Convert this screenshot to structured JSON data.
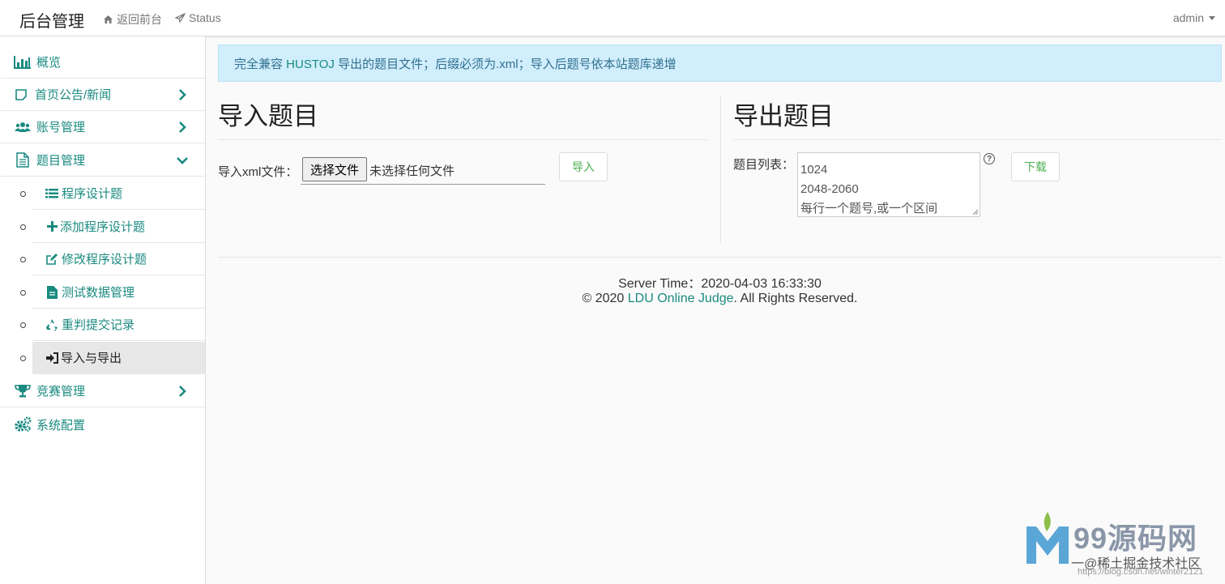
{
  "navbar": {
    "brand": "后台管理",
    "home_link": "返回前台",
    "status_link": "Status",
    "user": "admin"
  },
  "sidebar": {
    "items": [
      {
        "label": "概览",
        "icon": "bar-chart-icon"
      },
      {
        "label": "首页公告/新闻",
        "icon": "square-icon",
        "expandable": true
      },
      {
        "label": "账号管理",
        "icon": "users-icon",
        "expandable": true
      },
      {
        "label": "题目管理",
        "icon": "file-text-icon",
        "expanded": true
      },
      {
        "label": "竞赛管理",
        "icon": "trophy-icon",
        "expandable": true
      },
      {
        "label": "系统配置",
        "icon": "gears-icon"
      }
    ],
    "subitems": [
      {
        "label": "程序设计题",
        "icon": "list-icon"
      },
      {
        "label": "添加程序设计题",
        "icon": "plus-icon"
      },
      {
        "label": "修改程序设计题",
        "icon": "edit-icon"
      },
      {
        "label": "测试数据管理",
        "icon": "file-icon"
      },
      {
        "label": "重判提交记录",
        "icon": "recycle-icon"
      },
      {
        "label": "导入与导出",
        "icon": "sign-in-icon",
        "active": true
      }
    ]
  },
  "alert": {
    "prefix": "完全兼容 ",
    "highlight": "HUSTOJ",
    "suffix": " 导出的题目文件；后缀必须为.xml；导入后题号依本站题库递增"
  },
  "import": {
    "title": "导入题目",
    "label": "导入xml文件：",
    "file_button": "选择文件",
    "file_status": "未选择任何文件",
    "submit": "导入"
  },
  "export": {
    "title": "导出题目",
    "label": "题目列表：",
    "placeholder_lines": [
      "1024",
      "2048-2060",
      "每行一个题号,或一个区间"
    ],
    "submit": "下载"
  },
  "footer": {
    "server_time_label": "Server Time：",
    "server_time": "2020-04-03 16:33:30",
    "copyright_prefix": "© 2020 ",
    "site_name": "LDU Online Judge",
    "copyright_suffix": ". All Rights Reserved."
  },
  "watermark": {
    "title": "99源码网",
    "subtitle": "一@稀土掘金技术社区",
    "url": "https://blog.csdn.net/winter2121"
  },
  "colors": {
    "accent": "#1a8a80",
    "alert_bg": "#d1eefc",
    "button_text": "#4caf50"
  }
}
